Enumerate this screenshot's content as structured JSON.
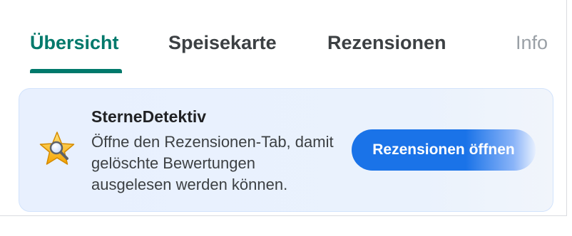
{
  "tabs": [
    {
      "label": "Übersicht",
      "active": true
    },
    {
      "label": "Speisekarte",
      "active": false
    },
    {
      "label": "Rezensionen",
      "active": false
    },
    {
      "label": "Info",
      "active": false
    }
  ],
  "banner": {
    "icon": "star-magnifier-icon",
    "title": "SterneDetektiv",
    "text": "Öffne den Rezensionen-Tab, damit gelöschte Bewertungen ausgelesen werden können.",
    "button_label": "Rezensionen öffnen"
  },
  "colors": {
    "accent": "#00796b",
    "button": "#1a73e8",
    "card_background": "#e8f0fe",
    "star": "#fbbc04"
  }
}
